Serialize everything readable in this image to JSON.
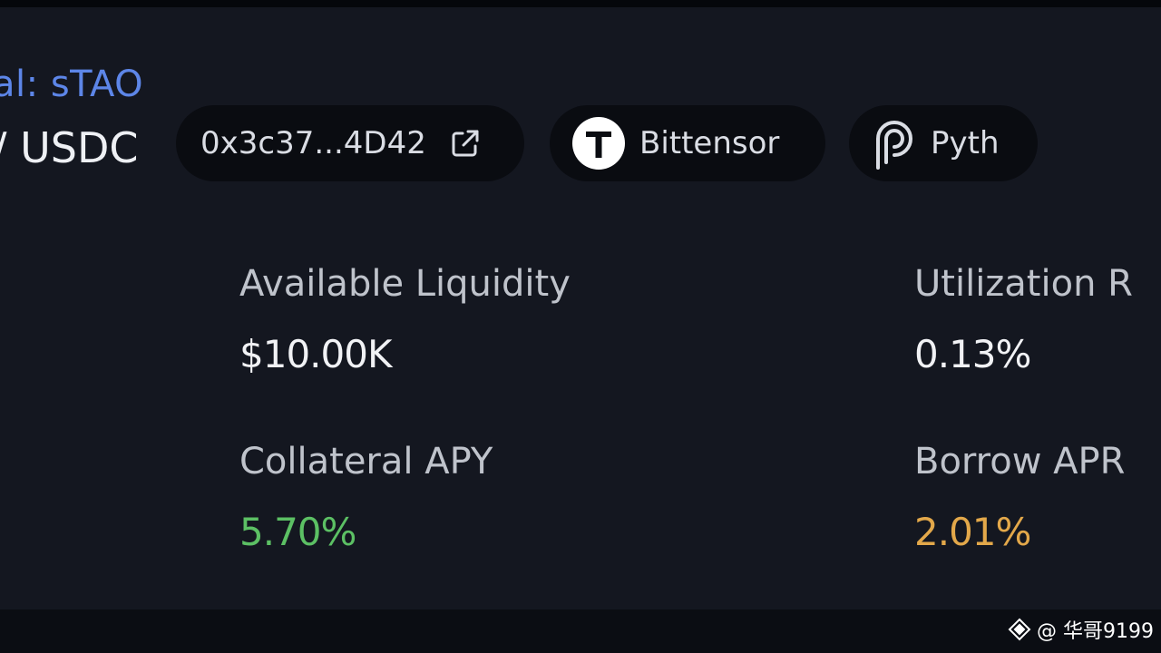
{
  "header": {
    "collateral_label": "al: sTAO",
    "pair_label": "/ USDC"
  },
  "chips": {
    "address": {
      "text": "0x3c37...4D42",
      "icon": "external-link-icon"
    },
    "network": {
      "label": "Bittensor",
      "icon": "bittensor-logo-icon"
    },
    "oracle": {
      "label": "Pyth",
      "icon": "pyth-logo-icon"
    }
  },
  "stats": {
    "available_liquidity": {
      "label": "Available Liquidity",
      "value": "$10.00K",
      "color": "#f1f2f5"
    },
    "utilization_rate": {
      "label": "Utilization R",
      "value": "0.13%",
      "color": "#f1f2f5"
    },
    "collateral_apy": {
      "label": "Collateral APY",
      "value": "5.70%",
      "color": "#5cc064"
    },
    "borrow_apr": {
      "label": "Borrow APR",
      "value": "2.01%",
      "color": "#e3a84a"
    }
  },
  "watermark": {
    "text": "@ 华哥9199",
    "icon": "binance-square-icon"
  }
}
